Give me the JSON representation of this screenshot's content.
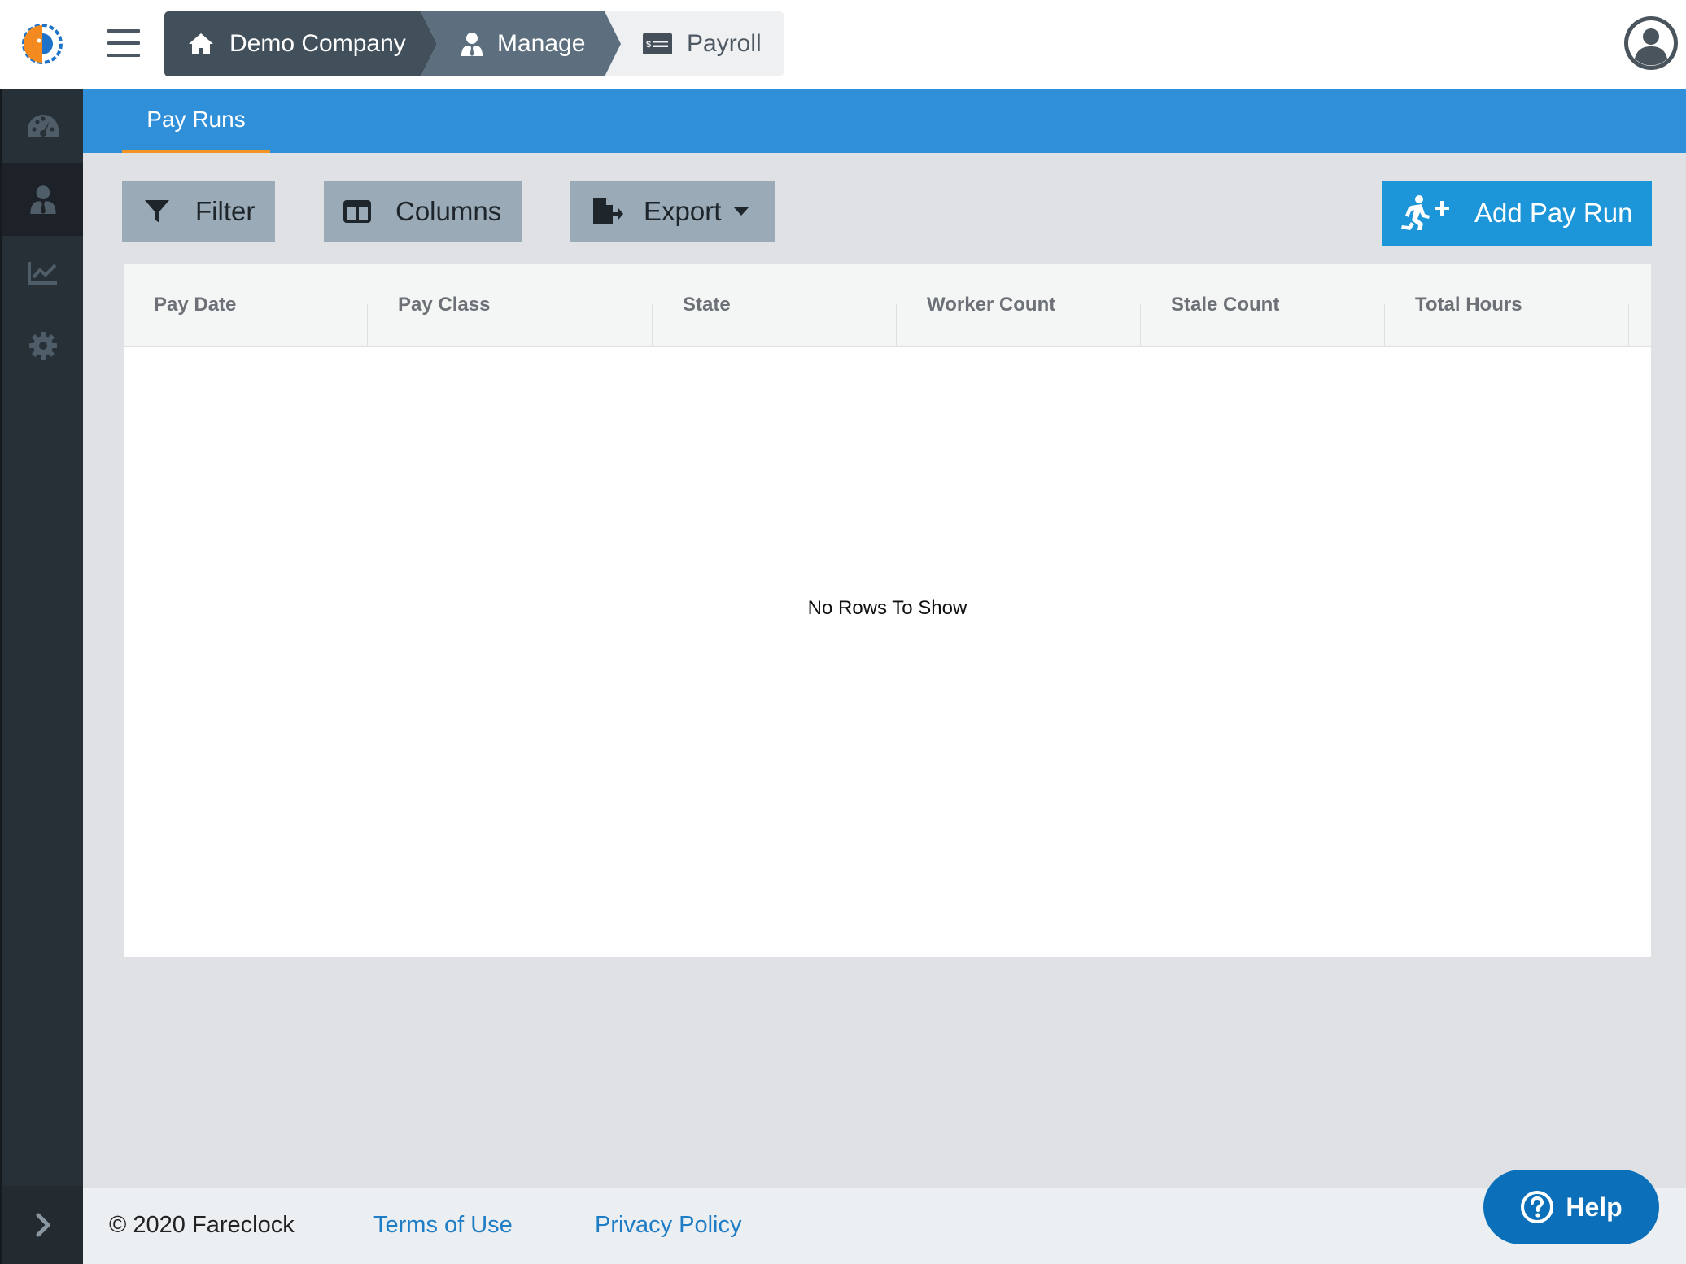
{
  "header": {
    "breadcrumb": [
      {
        "label": "Demo Company",
        "icon": "home-icon"
      },
      {
        "label": "Manage",
        "icon": "user-tie-icon"
      },
      {
        "label": "Payroll",
        "icon": "money-check-icon"
      }
    ]
  },
  "sidebar": {
    "items": [
      {
        "icon": "dashboard-icon",
        "active": false
      },
      {
        "icon": "user-tie-icon",
        "active": true
      },
      {
        "icon": "chart-line-icon",
        "active": false
      },
      {
        "icon": "gear-icon",
        "active": false
      }
    ],
    "expand_icon": "chevron-right-icon"
  },
  "tabs": [
    {
      "label": "Pay Runs",
      "active": true
    }
  ],
  "toolbar": {
    "filter_label": "Filter",
    "columns_label": "Columns",
    "export_label": "Export",
    "add_label": "Add Pay Run"
  },
  "grid": {
    "columns": [
      "Pay Date",
      "Pay Class",
      "State",
      "Worker Count",
      "Stale Count",
      "Total Hours"
    ],
    "rows": [],
    "empty_message": "No Rows To Show"
  },
  "footer": {
    "copyright": "© 2020 Fareclock",
    "terms_label": "Terms of Use",
    "privacy_label": "Privacy Policy"
  },
  "help": {
    "label": "Help"
  },
  "colors": {
    "tab_bar": "#2f8fd9",
    "tab_underline": "#f39324",
    "sidebar": "#283037",
    "primary_button": "#1c96d8",
    "secondary_button": "#9aaab6",
    "help_button": "#0b6fb9",
    "link": "#1f7dc6"
  }
}
